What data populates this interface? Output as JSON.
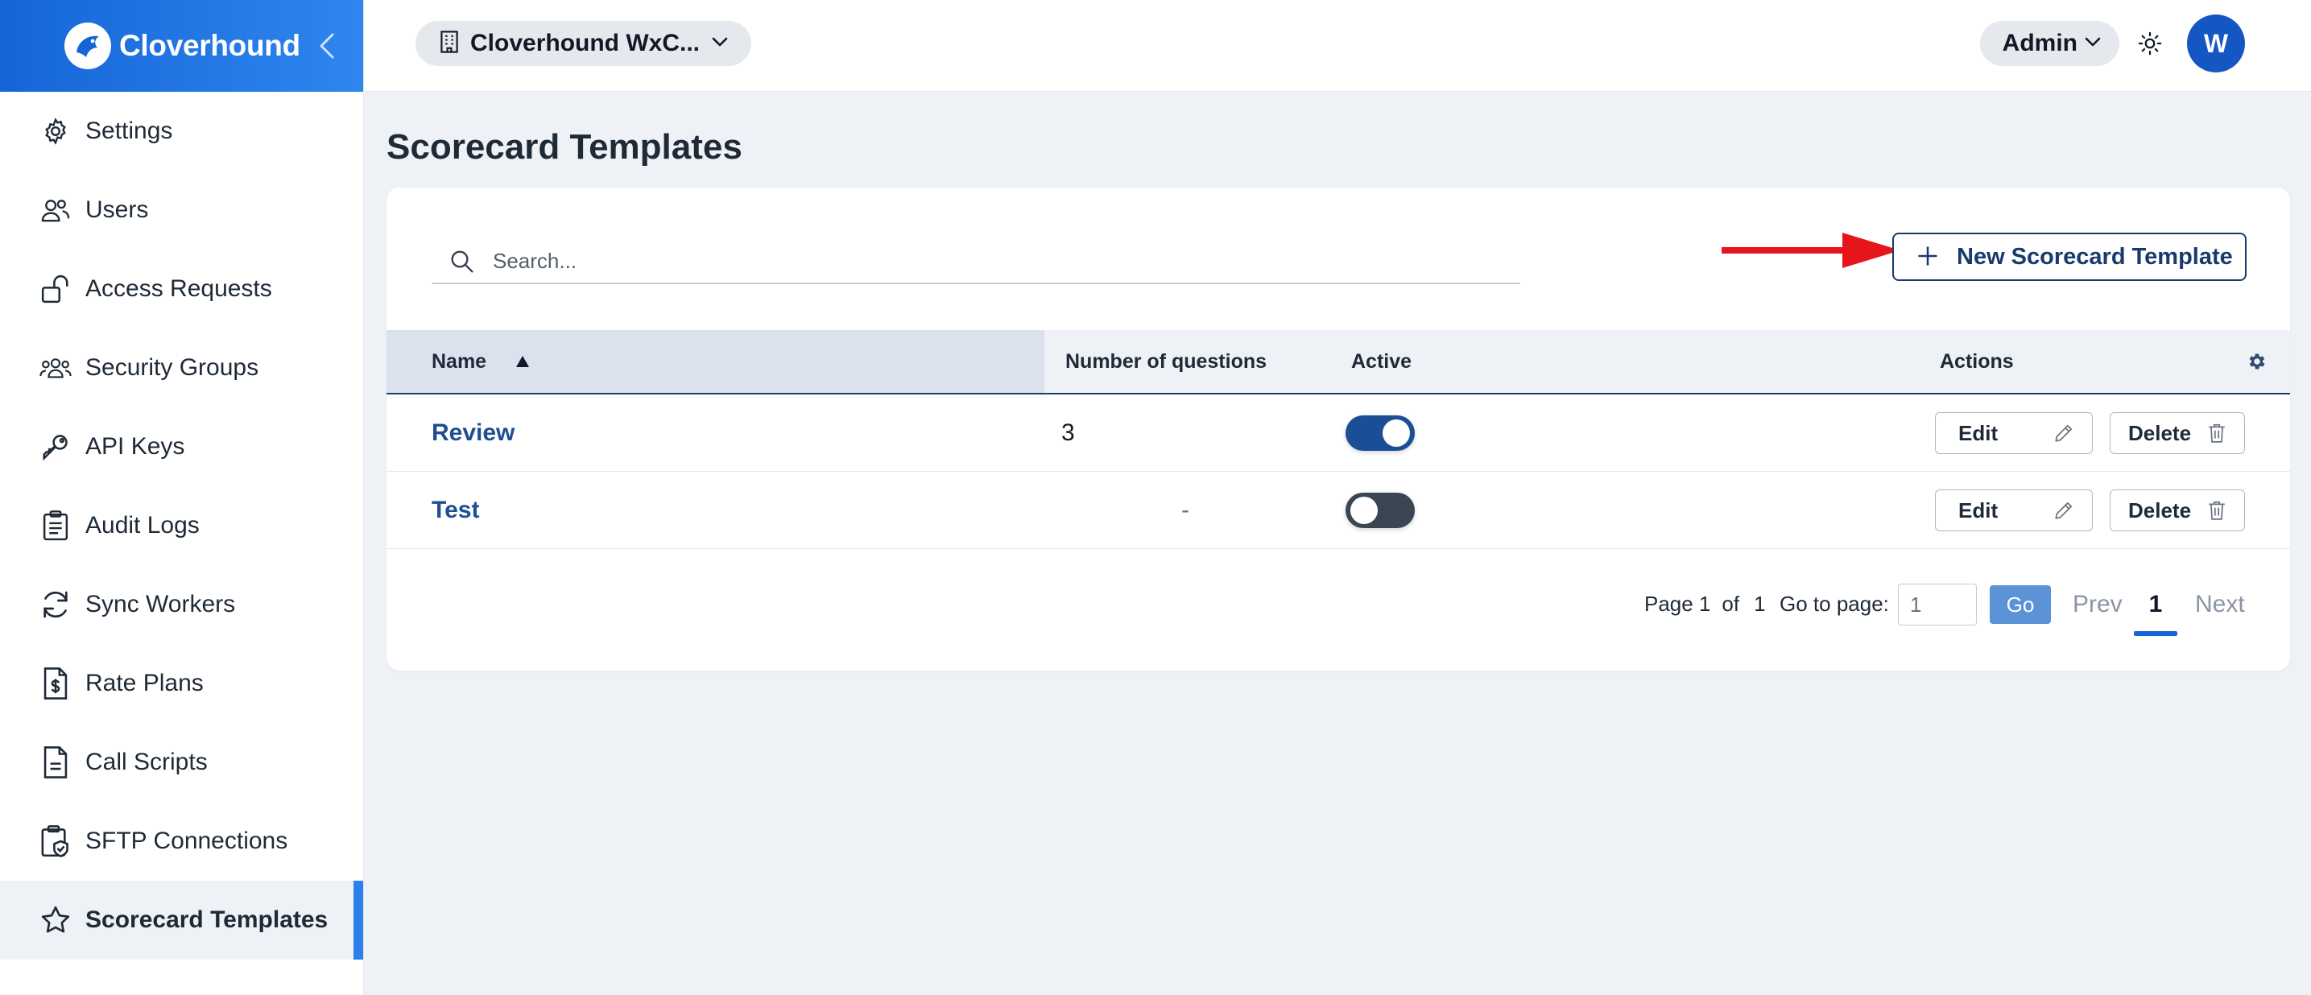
{
  "brand": {
    "name": "Cloverhound",
    "accent": "#1565d8"
  },
  "sidebar": {
    "items": [
      {
        "label": "Settings",
        "icon": "gear-icon"
      },
      {
        "label": "Users",
        "icon": "users-icon"
      },
      {
        "label": "Access Requests",
        "icon": "unlock-icon"
      },
      {
        "label": "Security Groups",
        "icon": "group-icon"
      },
      {
        "label": "API Keys",
        "icon": "key-icon"
      },
      {
        "label": "Audit Logs",
        "icon": "clipboard-icon"
      },
      {
        "label": "Sync Workers",
        "icon": "sync-icon"
      },
      {
        "label": "Rate Plans",
        "icon": "dollar-file-icon"
      },
      {
        "label": "Call Scripts",
        "icon": "document-icon"
      },
      {
        "label": "SFTP Connections",
        "icon": "shield-clipboard-icon"
      },
      {
        "label": "Scorecard Templates",
        "icon": "star-icon",
        "active": true
      }
    ]
  },
  "topbar": {
    "tenant": "Cloverhound WxC...",
    "role": "Admin",
    "avatar_initial": "W"
  },
  "page": {
    "title": "Scorecard Templates"
  },
  "search": {
    "placeholder": "Search...",
    "value": ""
  },
  "new_button": {
    "label": "New Scorecard Template"
  },
  "table": {
    "headers": {
      "name": "Name",
      "questions": "Number of questions",
      "active": "Active",
      "actions": "Actions"
    },
    "rows": [
      {
        "name": "Review",
        "questions": "3",
        "active": true,
        "edit": "Edit",
        "delete": "Delete"
      },
      {
        "name": "Test",
        "questions": "-",
        "active": false,
        "edit": "Edit",
        "delete": "Delete"
      }
    ]
  },
  "pagination": {
    "page_label": "Page 1",
    "of_label": "of",
    "total": "1",
    "goto_label": "Go to page:",
    "goto_value": "1",
    "go": "Go",
    "prev": "Prev",
    "current": "1",
    "next": "Next"
  },
  "colors": {
    "annotation_arrow": "#e8141c",
    "primary_dark": "#183a6d",
    "link": "#1d4f91"
  }
}
